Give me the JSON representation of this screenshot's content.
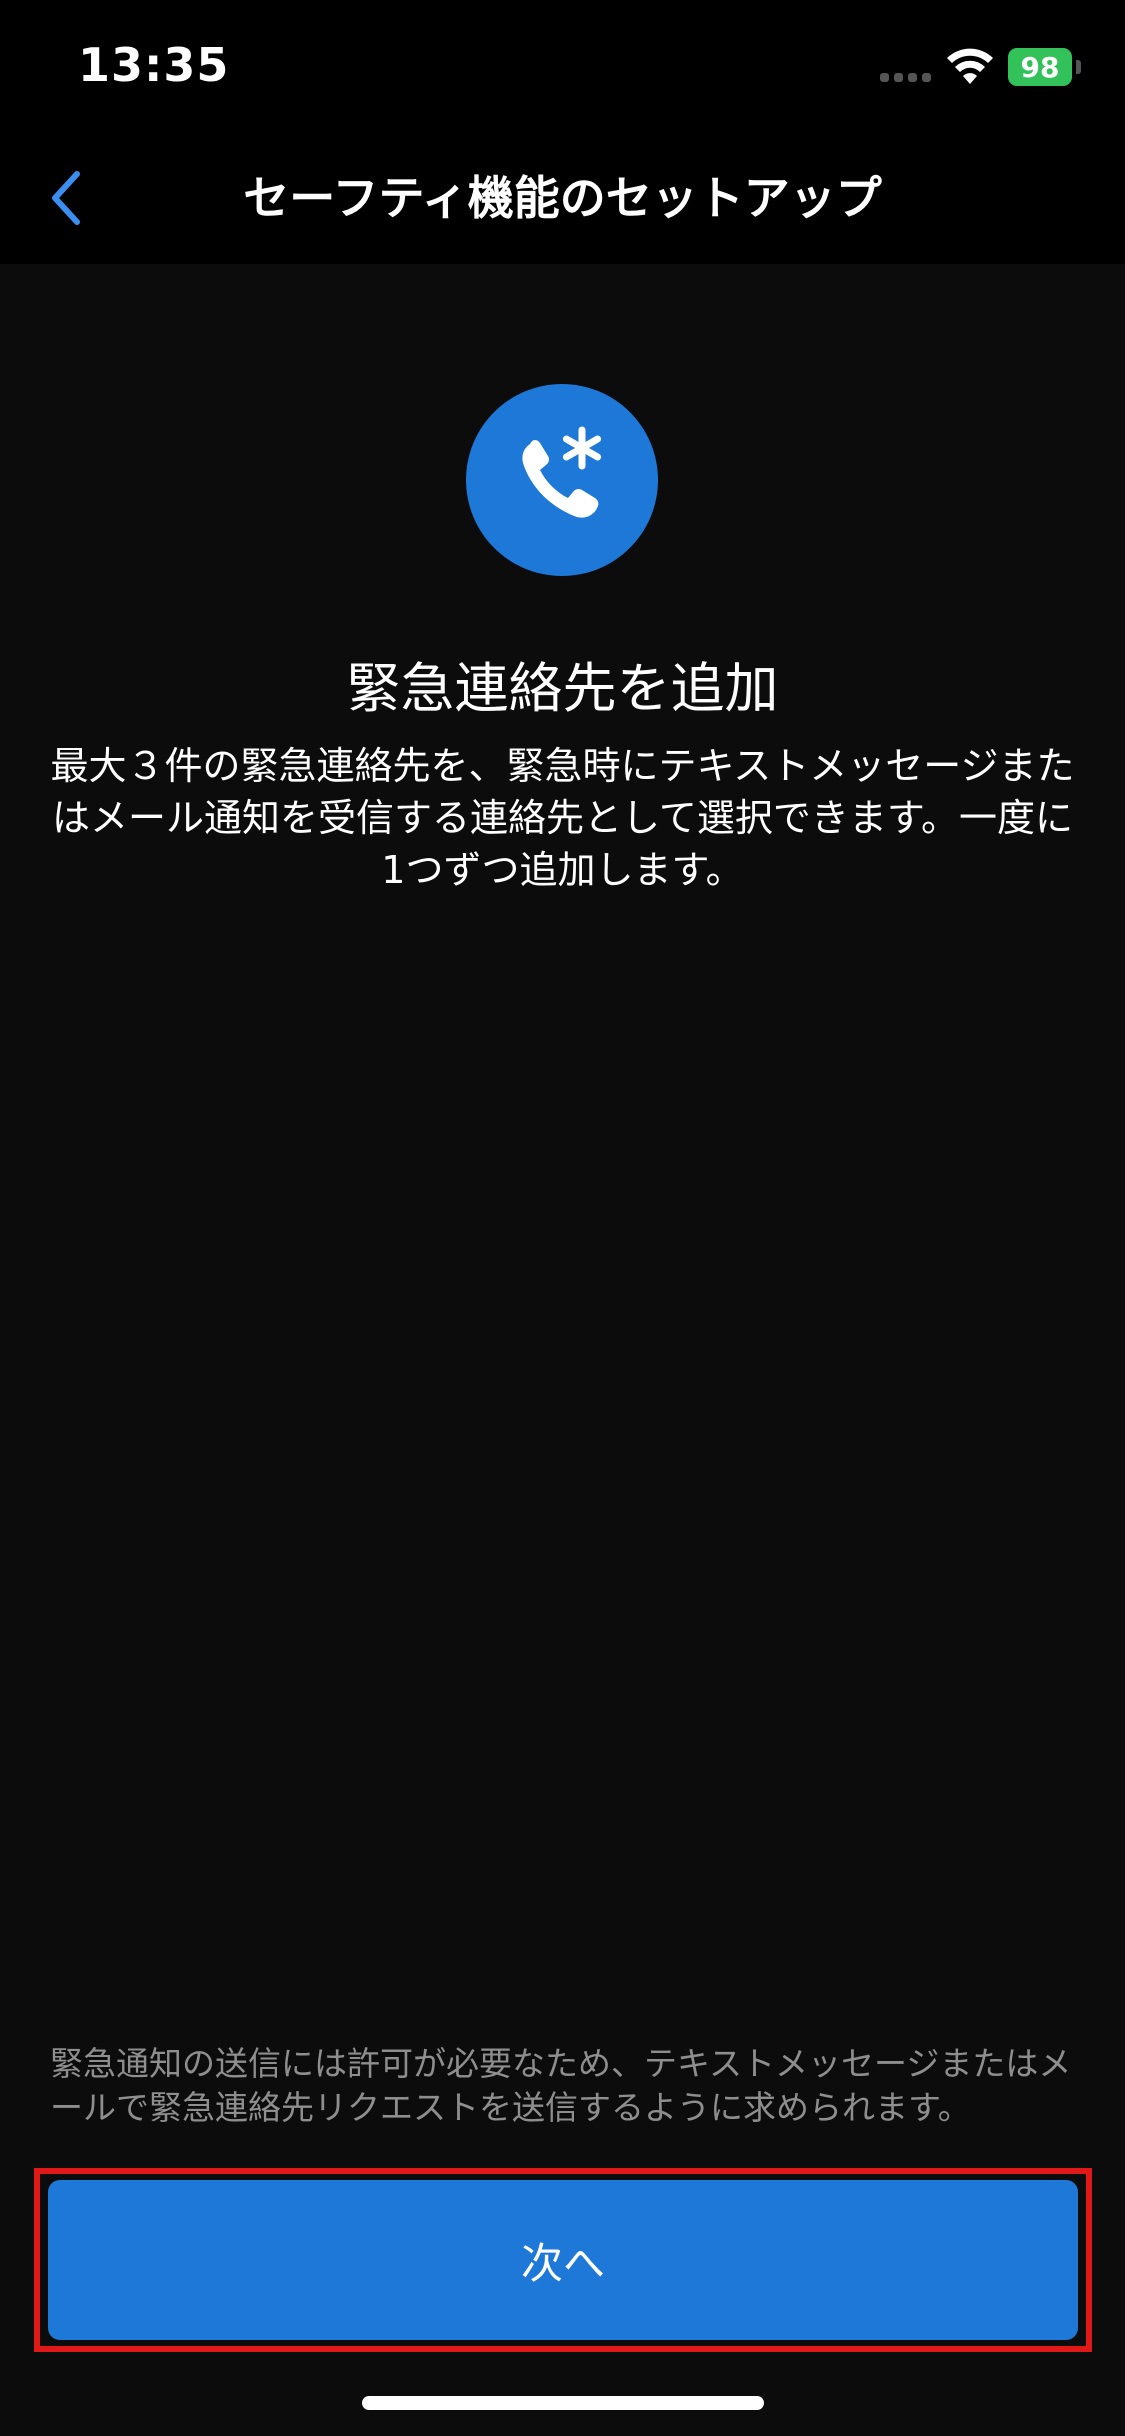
{
  "status_bar": {
    "time": "13:35",
    "battery_level": "98"
  },
  "nav": {
    "back_icon": "chevron-left-icon",
    "title": "セーフティ機能のセットアップ"
  },
  "hero": {
    "icon": "phone-asterisk-icon"
  },
  "content": {
    "heading": "緊急連絡先を追加",
    "description": "最大３件の緊急連絡先を、緊急時にテキストメッセージまたはメール通知を受信する連絡先として選択できます。一度に1つずつ追加します。",
    "footnote": "緊急通知の送信には許可が必要なため、テキストメッセージまたはメールで緊急連絡先リクエストを送信するように求められます。"
  },
  "actions": {
    "next_label": "次へ"
  },
  "colors": {
    "accent": "#1e78d8",
    "highlight_border": "#e01818",
    "background": "#0c0c0c",
    "battery": "#33c15a"
  }
}
